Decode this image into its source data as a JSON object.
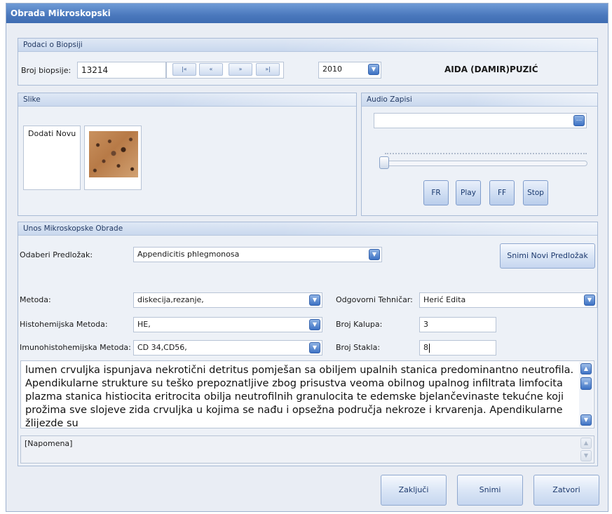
{
  "window": {
    "title": "Obrada Mikroskopski"
  },
  "biopsy": {
    "header": "Podaci o Biopsiji",
    "number_label": "Broj biopsije:",
    "number_value": "13214",
    "nav": {
      "first": "|«",
      "prev": "«",
      "next": "»",
      "last": "»|"
    },
    "year": "2010",
    "patient_name": "AIDA (DAMIR)PUZIĆ"
  },
  "images": {
    "header": "Slike",
    "add_new": "Dodati Novu"
  },
  "audio": {
    "header": "Audio Zapisi",
    "browse": "...",
    "progress": 0.0,
    "buttons": {
      "fr": "FR",
      "play": "Play",
      "ff": "FF",
      "stop": "Stop"
    }
  },
  "entry": {
    "header": "Unos Mikroskopske Obrade",
    "template_label": "Odaberi Predložak:",
    "template_value": "Appendicitis phlegmonosa",
    "save_template_button": "Snimi Novi Predložak",
    "method_label": "Metoda:",
    "method_value": "diskecija,rezanje,",
    "histo_label": "Histohemijska Metoda:",
    "histo_value": "HE,",
    "immuno_label": "Imunohistohemijska Metoda:",
    "immuno_value": "CD 34,CD56,",
    "tech_label": "Odgovorni Tehničar:",
    "tech_value": "Herić Edita",
    "blocks_label": "Broj Kalupa:",
    "blocks_value": "3",
    "slides_label": "Broj Stakla:",
    "slides_value": "8",
    "description": "lumen crvuljka ispunjava nekrotični detritus pomješan sa obiljem upalnih stanica predominantno neutrofila. Apendikularne strukture su teško prepoznatljive zbog prisustva veoma obilnog upalnog infiltrata limfocita plazma stanica histiocita eritrocita obilja neutrofilnih granulocita te edemske bjelančevinaste tekućne koji prožima sve slojeve zida crvuljka u kojima se nađu i opsežna područja nekroze i krvarenja. Apendikularne žlijezde su",
    "note": "[Napomena]"
  },
  "footer": {
    "finish": "Zaključi",
    "save": "Snimi",
    "close": "Zatvori"
  }
}
